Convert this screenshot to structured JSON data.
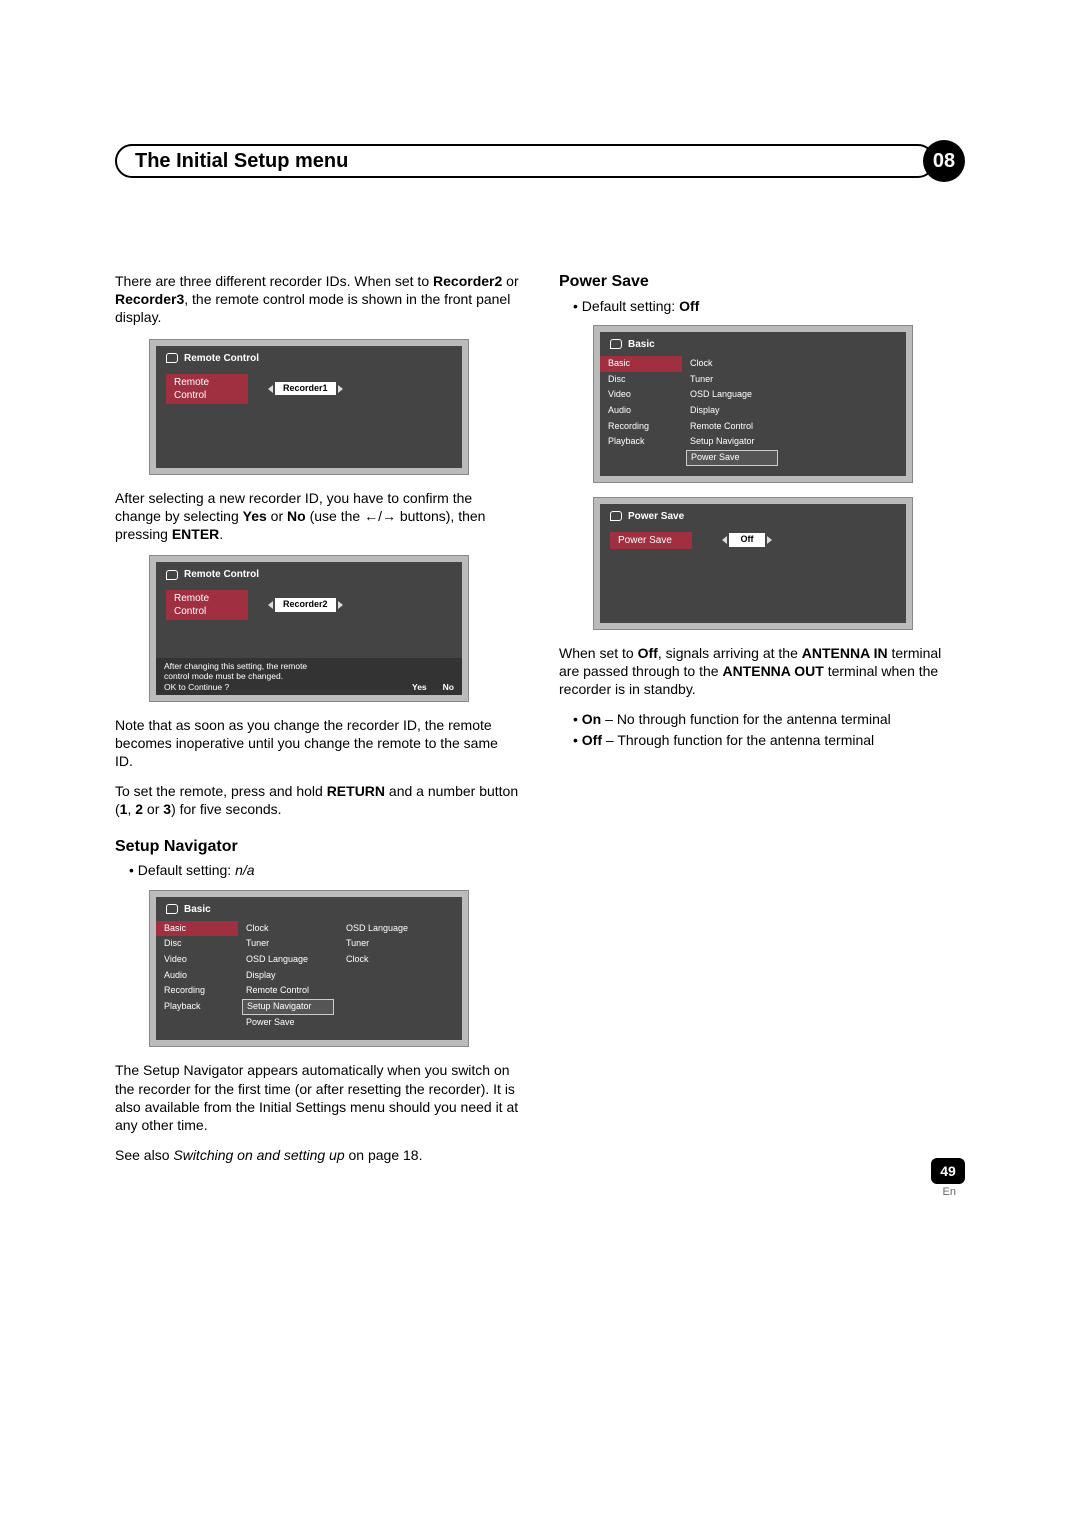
{
  "chapter": {
    "title": "The Initial Setup menu",
    "number": "08"
  },
  "left": {
    "p1a": "There are three different recorder IDs. When set to ",
    "p1b": "Recorder2",
    "p1c": " or ",
    "p1d": "Recorder3",
    "p1e": ", the remote control mode is shown in the front panel display.",
    "osd1": {
      "title": "Remote Control",
      "label": "Remote Control",
      "value": "Recorder1"
    },
    "p2a": "After selecting a new recorder ID, you have to confirm the change by selecting ",
    "p2b": "Yes",
    "p2c": " or ",
    "p2d": "No",
    "p2e": " (use the ",
    "p2f": " buttons), then pressing ",
    "p2g": "ENTER",
    "p2h": ".",
    "osd2": {
      "title": "Remote Control",
      "label": "Remote Control",
      "value": "Recorder2",
      "footer1": "After changing this setting, the remote",
      "footer2": "control mode must be changed.",
      "footer3": "OK to Continue ?",
      "yes": "Yes",
      "no": "No"
    },
    "p3": "Note that as soon as you change the recorder ID, the remote becomes inoperative until you change the remote to the same ID.",
    "p4a": "To set the remote, press and hold ",
    "p4b": "RETURN",
    "p4c": " and a number button (",
    "p4d": "1",
    "p4e": ", ",
    "p4f": "2",
    "p4g": " or ",
    "p4h": "3",
    "p4i": ") for five seconds.",
    "setupnav": {
      "heading": "Setup Navigator",
      "default_pre": "Default setting: ",
      "default_val": "n/a"
    },
    "osd3": {
      "title": "Basic",
      "left_items": [
        "Basic",
        "Disc",
        "Video",
        "Audio",
        "Recording",
        "Playback"
      ],
      "mid_items": [
        "Clock",
        "Tuner",
        "OSD Language",
        "Display",
        "Remote Control",
        "Setup Navigator",
        "Power Save"
      ],
      "mid_selected": "Setup Navigator",
      "right_items": [
        "OSD Language",
        "Tuner",
        "Clock"
      ]
    },
    "p5": "The Setup Navigator appears automatically when you switch on the recorder for the first time (or after resetting the recorder). It is also available from the Initial Settings menu should you need it at any other time.",
    "p6a": "See also ",
    "p6b": "Switching on and setting up",
    "p6c": " on page 18."
  },
  "right": {
    "powersave": {
      "heading": "Power Save",
      "default_pre": "Default setting: ",
      "default_val": "Off"
    },
    "osd4": {
      "title": "Basic",
      "left_items": [
        "Basic",
        "Disc",
        "Video",
        "Audio",
        "Recording",
        "Playback"
      ],
      "mid_items": [
        "Clock",
        "Tuner",
        "OSD Language",
        "Display",
        "Remote Control",
        "Setup Navigator",
        "Power Save"
      ],
      "mid_selected": "Power Save"
    },
    "osd5": {
      "title": "Power Save",
      "label": "Power Save",
      "value": "Off"
    },
    "p1a": "When set to ",
    "p1b": "Off",
    "p1c": ", signals arriving at the ",
    "p1d": "ANTENNA IN",
    "p1e": " terminal are passed through to the ",
    "p1f": "ANTENNA OUT",
    "p1g": " terminal when the recorder is in standby.",
    "li1a": "On",
    "li1b": " – No through function for the antenna terminal",
    "li2a": "Off",
    "li2b": " – Through function for the antenna terminal"
  },
  "footer": {
    "page": "49",
    "lang": "En"
  }
}
